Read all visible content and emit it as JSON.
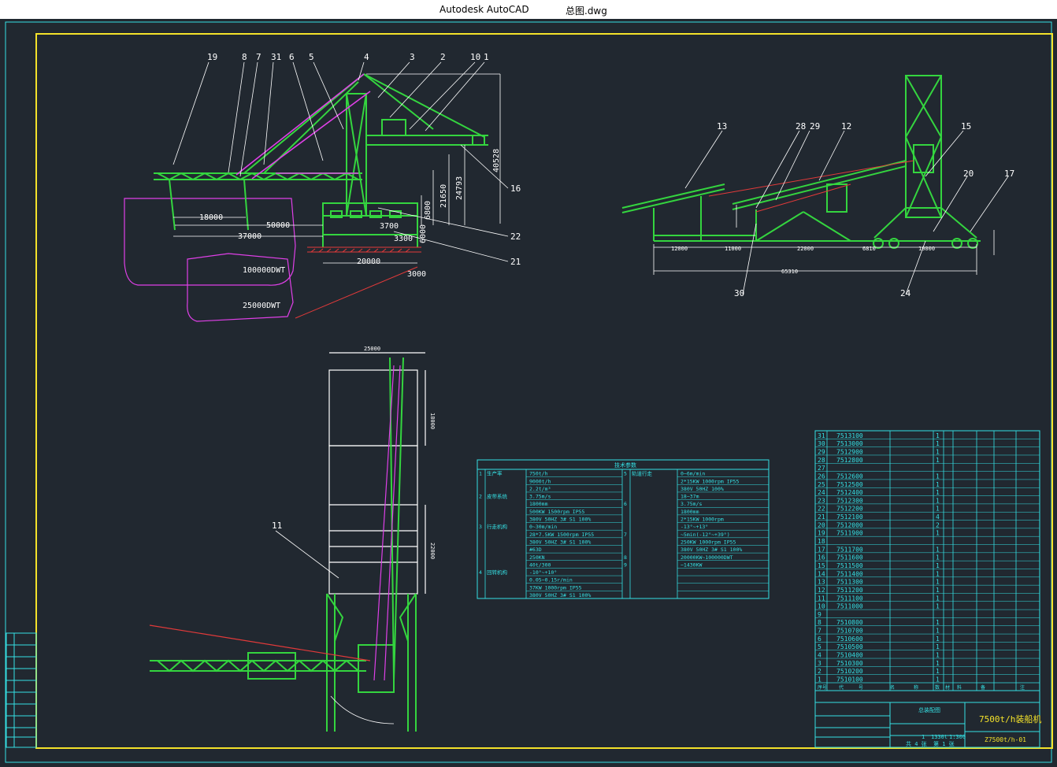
{
  "window": {
    "app_title": "Autodesk AutoCAD",
    "file_name": "总图.dwg"
  },
  "colors": {
    "background": "#212830",
    "frame": "#35e0e4",
    "border": "#f4e22a",
    "machine": "#34d53f",
    "accent": "#e040e8",
    "leader": "#ffffff",
    "hatch": "#e23a3a"
  },
  "elevation_view": {
    "balloons": [
      "19",
      "8",
      "7",
      "31",
      "6",
      "5",
      "4",
      "3",
      "2",
      "10",
      "1",
      "16",
      "22",
      "21"
    ],
    "dimensions": [
      "18000",
      "50000",
      "37000",
      "3700",
      "3300",
      "20000",
      "3000",
      "6000",
      "6800",
      "21650",
      "24793",
      "40528"
    ],
    "ship_labels": [
      "100000DWT",
      "25000DWT"
    ]
  },
  "side_view": {
    "balloons": [
      "13",
      "28",
      "29",
      "12",
      "15",
      "20",
      "17",
      "30",
      "24"
    ],
    "dimensions": [
      "12000",
      "11000",
      "22000",
      "6810",
      "10000",
      "65310"
    ]
  },
  "plan_view": {
    "balloons": [
      "11"
    ],
    "dimensions": [
      "25000",
      "18000",
      "22000"
    ]
  },
  "spec_table": {
    "title": "技术参数",
    "rows": [
      [
        "1",
        "生产率",
        "750t/h",
        "5",
        "轨道行走",
        "0~6m/min"
      ],
      [
        "",
        "",
        "9000t/h",
        "",
        "",
        "2*15KW 1000rpm IP55"
      ],
      [
        "",
        "",
        "2.2t/m³",
        "",
        "",
        "380V 50HZ 100%"
      ],
      [
        "2",
        "皮带系统",
        "3.75m/s",
        "",
        "",
        "18~37m"
      ],
      [
        "",
        "",
        "1800mm",
        "6",
        "",
        "3.75m/s"
      ],
      [
        "",
        "",
        "500KW 1500rpm IP55",
        "",
        "",
        "1800mm"
      ],
      [
        "",
        "",
        "380V 50HZ 3# S1 100%",
        "",
        "",
        "2*15KW 1000rpm"
      ],
      [
        "3",
        "行走机构",
        "0~30m/min",
        "",
        "",
        "-13°~+13°"
      ],
      [
        "",
        "",
        "28*7.5KW 1500rpm IP55",
        "7",
        "",
        "~5min(-12°~+39°)"
      ],
      [
        "",
        "",
        "380V 50HZ 3# S1 100%",
        "",
        "",
        "250KW 1000rpm IP55"
      ],
      [
        "",
        "",
        "#63D",
        "",
        "",
        "380V 50HZ 3# S1 100%"
      ],
      [
        "",
        "",
        "250KN",
        "8",
        "",
        "20000KW~100000DWT"
      ],
      [
        "",
        "",
        "40t/300",
        "9",
        "",
        "~1430KW"
      ],
      [
        "4",
        "回转机构",
        "-10°~+10°",
        "",
        "",
        ""
      ],
      [
        "",
        "",
        "0.05~0.15r/min",
        "",
        "",
        ""
      ],
      [
        "",
        "",
        "37KW 1000rpm IP55",
        "",
        "",
        ""
      ],
      [
        "",
        "",
        "380V 50HZ 3# S1 100%",
        "",
        "",
        ""
      ]
    ]
  },
  "parts_list": [
    {
      "no": "31",
      "code": "7513100",
      "qty": "1"
    },
    {
      "no": "30",
      "code": "7513000",
      "qty": "1"
    },
    {
      "no": "29",
      "code": "7512900",
      "qty": "1"
    },
    {
      "no": "28",
      "code": "7512800",
      "qty": "1"
    },
    {
      "no": "27",
      "code": "",
      "qty": ""
    },
    {
      "no": "26",
      "code": "7512600",
      "qty": "1"
    },
    {
      "no": "25",
      "code": "7512500",
      "qty": "1"
    },
    {
      "no": "24",
      "code": "7512400",
      "qty": "1"
    },
    {
      "no": "23",
      "code": "7512300",
      "qty": "1"
    },
    {
      "no": "22",
      "code": "7512200",
      "qty": "1"
    },
    {
      "no": "21",
      "code": "7512100",
      "qty": "4"
    },
    {
      "no": "20",
      "code": "7512000",
      "qty": "2"
    },
    {
      "no": "19",
      "code": "7511900",
      "qty": "1"
    },
    {
      "no": "18",
      "code": "",
      "qty": ""
    },
    {
      "no": "17",
      "code": "7511700",
      "qty": "1"
    },
    {
      "no": "16",
      "code": "7511600",
      "qty": "1"
    },
    {
      "no": "15",
      "code": "7511500",
      "qty": "1"
    },
    {
      "no": "14",
      "code": "7511400",
      "qty": "1"
    },
    {
      "no": "13",
      "code": "7511300",
      "qty": "1"
    },
    {
      "no": "12",
      "code": "7511200",
      "qty": "1"
    },
    {
      "no": "11",
      "code": "7511100",
      "qty": "1"
    },
    {
      "no": "10",
      "code": "7511000",
      "qty": "1"
    },
    {
      "no": "9",
      "code": "",
      "qty": ""
    },
    {
      "no": "8",
      "code": "7510800",
      "qty": "1"
    },
    {
      "no": "7",
      "code": "7510700",
      "qty": "1"
    },
    {
      "no": "6",
      "code": "7510600",
      "qty": "1"
    },
    {
      "no": "5",
      "code": "7510500",
      "qty": "1"
    },
    {
      "no": "4",
      "code": "7510400",
      "qty": "1"
    },
    {
      "no": "3",
      "code": "7510300",
      "qty": "1"
    },
    {
      "no": "2",
      "code": "7510200",
      "qty": "1"
    },
    {
      "no": "1",
      "code": "7510100",
      "qty": "1"
    }
  ],
  "parts_header": [
    "序号",
    "代",
    "号",
    "名",
    "称",
    "数",
    "材",
    "料",
    "备",
    "注"
  ],
  "title_block": {
    "drawing_name": "7500t/h装船机",
    "drawing_no": "Z7500t/h-01",
    "scale": "1:300",
    "label": "总装配图",
    "qty": "1",
    "weight": "1330t",
    "sheets": "共 4 张",
    "sheet_no": "第 1 张"
  }
}
